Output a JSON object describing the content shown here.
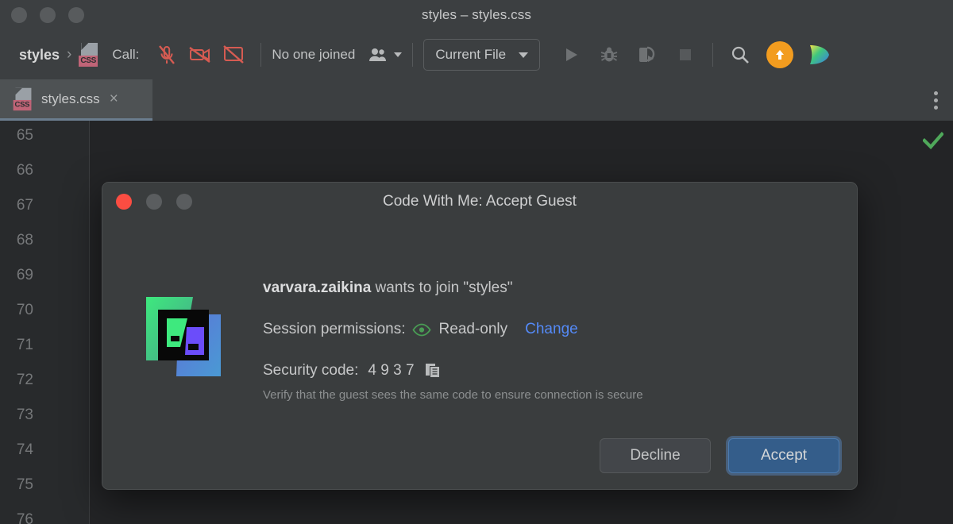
{
  "window": {
    "title": "styles – styles.css",
    "traffic_lights": [
      "close",
      "minimize",
      "zoom"
    ]
  },
  "toolbar": {
    "project_name": "styles",
    "breadcrumb_separator": "›",
    "file_icon": "css-file-icon",
    "call_label": "Call:",
    "mic_icon": "microphone-muted-icon",
    "camera_icon": "camera-off-icon",
    "screenshare_icon": "screen-share-off-icon",
    "joined_status": "No one joined",
    "people_icon": "people-icon",
    "people_caret": "chevron-down-icon",
    "run_config": "Current File",
    "run_config_caret": "chevron-down-icon",
    "run_icon": "run-play-icon",
    "debug_icon": "debug-bug-icon",
    "coverage_icon": "run-with-coverage-icon",
    "stop_icon": "stop-square-icon",
    "search_icon": "search-magnifier-icon",
    "update_icon": "upload-arrow-icon",
    "ai_icon": "gradient-assistant-icon"
  },
  "tabbar": {
    "tabs": [
      {
        "label": "styles.css",
        "icon": "css-file-icon",
        "close": "×",
        "active": true
      }
    ],
    "kebab": "more-options-icon"
  },
  "editor": {
    "line_numbers": [
      "65",
      "66",
      "67",
      "68",
      "69",
      "70",
      "71",
      "72",
      "73",
      "74",
      "75",
      "76"
    ],
    "inspection_status_icon": "green-checkmark-icon"
  },
  "dialog": {
    "title": "Code With Me: Accept Guest",
    "traffic_lights": [
      "close",
      "minimize",
      "zoom"
    ],
    "logo": "code-with-me-logo",
    "guest_name": "varvara.zaikina",
    "join_text": " wants to join \"styles\"",
    "permissions_label": "Session permissions:",
    "permissions_icon": "eye-icon",
    "permissions_value": "Read-only",
    "change_link": "Change",
    "security_label": "Security code:",
    "security_code": "4 9 3 7",
    "copy_icon": "copy-to-clipboard-icon",
    "hint": "Verify that the guest sees the same code to ensure connection is secure",
    "decline_label": "Decline",
    "accept_label": "Accept"
  },
  "colors": {
    "chrome": "#3c3f41",
    "editor_bg": "#232426",
    "dialog_bg": "#3a3d3e",
    "accent_blue": "#548af7",
    "accept_button": "#345d8a",
    "permission_green": "#499c54",
    "close_red": "#fb4d42",
    "update_orange": "#f29c1f",
    "css_badge": "#c06477"
  }
}
